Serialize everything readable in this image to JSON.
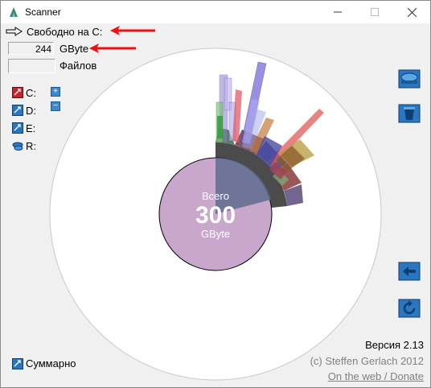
{
  "window": {
    "title": "Scanner"
  },
  "header": {
    "free_space_label": "Свободно на C:",
    "free_size": "244",
    "free_unit": "GByte",
    "files_value": "",
    "files_label": "Файлов"
  },
  "drives": [
    {
      "letter": "C:",
      "icon": "drive-red-icon",
      "color": "#c0262d"
    },
    {
      "letter": "D:",
      "icon": "drive-blue-icon",
      "color": "#2a77c0"
    },
    {
      "letter": "E:",
      "icon": "drive-blue-icon",
      "color": "#2a77c0"
    },
    {
      "letter": "R:",
      "icon": "optical-drive-icon",
      "color": "#2a77c0"
    }
  ],
  "zoom": {
    "plus": "+",
    "minus": "−"
  },
  "center": {
    "label_top": "Всего",
    "total": "300",
    "unit": "GByte"
  },
  "colors": {
    "center_fill": "#c9a7cc",
    "used_wedge": "#5f6b8f",
    "outer_ring": "#ffffff"
  },
  "footer": {
    "version": "Версия 2.13",
    "copyright": "(c) Steffen Gerlach 2012",
    "link": "On the web / Donate",
    "summary": "Суммарно"
  },
  "right_toolbar": [
    "drive-scan-icon",
    "trash-icon",
    "back-arrow-icon",
    "refresh-icon"
  ]
}
